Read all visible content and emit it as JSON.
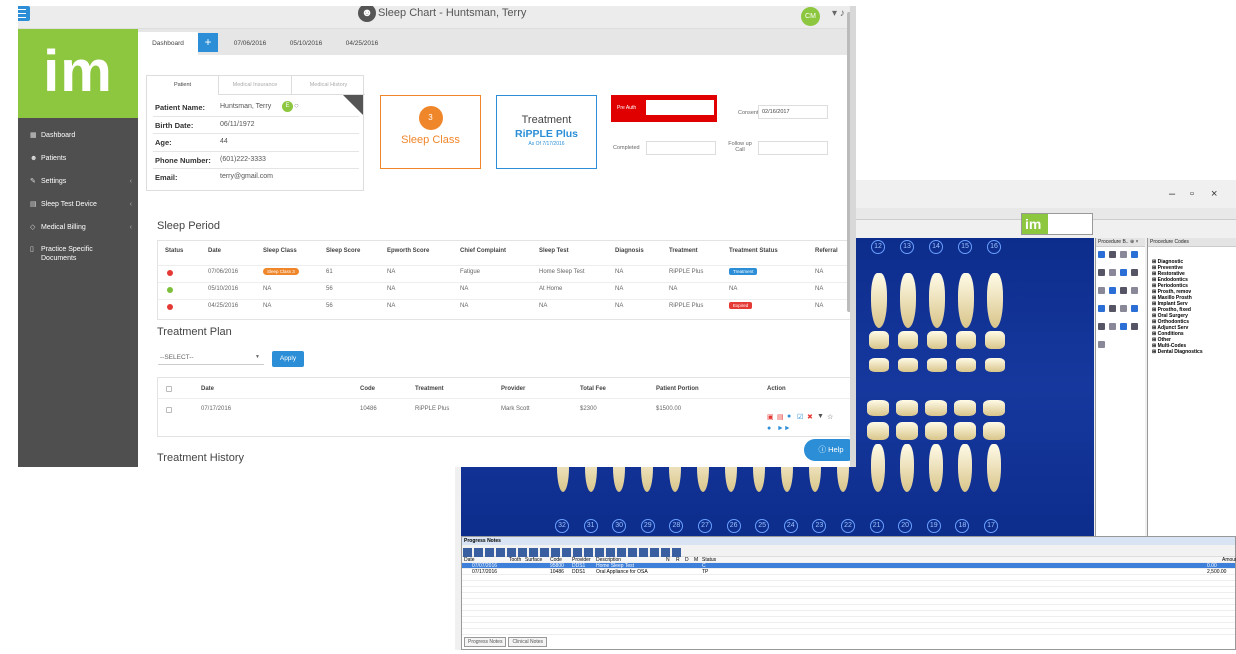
{
  "dental": {
    "win_controls": [
      "–",
      "▫",
      "×"
    ],
    "logo_text": "im",
    "upper_teeth": [
      "12",
      "13",
      "14",
      "15",
      "16"
    ],
    "lower_teeth": [
      "32",
      "31",
      "30",
      "29",
      "28",
      "27",
      "26",
      "25",
      "24",
      "23",
      "22",
      "21",
      "20",
      "19",
      "18",
      "17"
    ],
    "proc_panel_title": "Procedure B..  ⊕ ×",
    "codes_panel_title": "Procedure Codes",
    "codes": [
      "Diagnostic",
      "Preventive",
      "Restorative",
      "Endodontics",
      "Periodontics",
      "Prosth, remov",
      "Maxillo Prosth",
      "Implant Serv",
      "Prostho, fixed",
      "Oral Surgery",
      "Orthodontics",
      "Adjunct Serv",
      "Conditions",
      "Other",
      "Multi-Codes",
      "Dental Diagnostics"
    ],
    "progress_notes": {
      "title": "Progress Notes",
      "columns": [
        "Date",
        "Tooth",
        "Surface",
        "Code",
        "Provider",
        "Description",
        "N",
        "R",
        "D",
        "M",
        "Status",
        "Amount"
      ],
      "rows": [
        {
          "date": "07/07/2016",
          "code": "95800",
          "provider": "DDS1",
          "desc": "Home Sleep Test",
          "status": "C",
          "amount": "0.00"
        },
        {
          "date": "07/17/2016",
          "code": "10486",
          "provider": "DDS1",
          "desc": "Oral Appliance for OSA",
          "status": "TP",
          "amount": "2,500.00"
        }
      ],
      "tabs": [
        "Progress Notes",
        "Clinical Notes"
      ]
    }
  },
  "app": {
    "title": "Sleep Chart - Huntsman, Terry",
    "user_initials": "CM",
    "logo": "im"
  },
  "nav": [
    {
      "label": "Dashboard",
      "icon": "▦",
      "chev": ""
    },
    {
      "label": "Patients",
      "icon": "☻",
      "chev": ""
    },
    {
      "label": "Settings",
      "icon": "✎",
      "chev": "‹"
    },
    {
      "label": "Sleep Test Device",
      "icon": "▤",
      "chev": "‹"
    },
    {
      "label": "Medical Billing",
      "icon": "◇",
      "chev": "‹"
    },
    {
      "label": "Practice Specific Documents",
      "icon": "▯",
      "chev": ""
    }
  ],
  "tabs": [
    "Dashboard",
    "+",
    "07/06/2016",
    "05/10/2016",
    "04/25/2016"
  ],
  "patient_tabs": [
    "Patient",
    "Medical Insurance",
    "Medical History"
  ],
  "patient": {
    "name_label": "Patient Name:",
    "name": "Huntsman, Terry",
    "birth_label": "Birth Date:",
    "birth": "06/11/1972",
    "age_label": "Age:",
    "age": "44",
    "phone_label": "Phone Number:",
    "phone": "(601)222-3333",
    "email_label": "Email:",
    "email": "terry@gmail.com",
    "badge": "E"
  },
  "sleep_class": {
    "number": "3",
    "label": "Sleep Class"
  },
  "treatment_box": {
    "title": "Treatment",
    "name": "RiPPLE Plus",
    "as_of": "As Of 7/17/2016"
  },
  "preauth": {
    "label": "Pre Auth",
    "consent_label": "Consent",
    "consent": "02/16/2017",
    "completed_label": "Completed",
    "followup_label": "Follow up Call"
  },
  "sleep_period": {
    "title": "Sleep Period",
    "columns": [
      "Status",
      "Date",
      "Sleep Class",
      "Sleep Score",
      "Epworth Score",
      "Chief Complaint",
      "Sleep Test",
      "Diagnosis",
      "Treatment",
      "Treatment Status",
      "Referral"
    ],
    "rows": [
      {
        "status": "#e53935",
        "date": "07/06/2016",
        "class": "Sleep Class 3",
        "score": "61",
        "epworth": "NA",
        "complaint": "Fatigue",
        "test": "Home Sleep Test",
        "diag": "NA",
        "treat": "RiPPLE Plus",
        "tstatus": "Treatment",
        "tcolor": "#2b8ed6",
        "ref": "NA"
      },
      {
        "status": "#7cbf3a",
        "date": "05/10/2016",
        "class": "NA",
        "score": "56",
        "epworth": "NA",
        "complaint": "NA",
        "test": "At Home",
        "diag": "NA",
        "treat": "NA",
        "tstatus": "NA",
        "tcolor": "",
        "ref": "NA"
      },
      {
        "status": "#e53935",
        "date": "04/25/2016",
        "class": "NA",
        "score": "56",
        "epworth": "NA",
        "complaint": "NA",
        "test": "NA",
        "diag": "NA",
        "treat": "RiPPLE Plus",
        "tstatus": "Expired",
        "tcolor": "#e53935",
        "ref": "NA"
      }
    ]
  },
  "treatment_plan": {
    "title": "Treatment Plan",
    "select": "--SELECT--",
    "apply": "Apply",
    "columns": [
      "Date",
      "Code",
      "Treatment",
      "Provider",
      "Total Fee",
      "Patient Portion",
      "Action"
    ],
    "row": {
      "date": "07/17/2016",
      "code": "10486",
      "treatment": "RiPPLE Plus",
      "provider": "Mark Scott",
      "fee": "$2300",
      "portion": "$1500.00"
    }
  },
  "treatment_history": {
    "title": "Treatment History"
  },
  "help": "ⓘ Help"
}
